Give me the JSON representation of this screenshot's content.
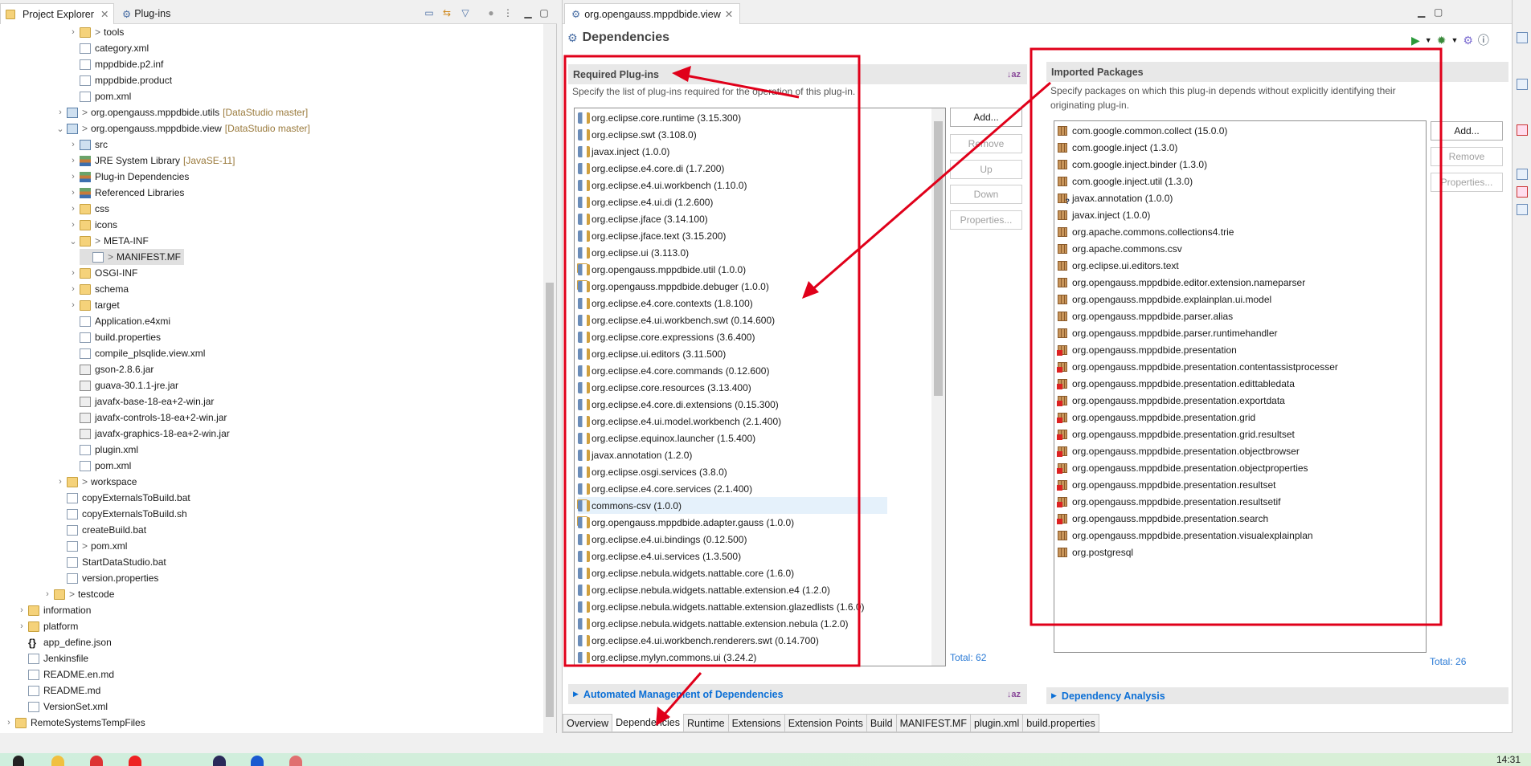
{
  "left_panel": {
    "tabs": [
      {
        "label": "Project Explorer",
        "active": true,
        "closable": true
      },
      {
        "label": "Plug-ins",
        "active": false
      }
    ],
    "toolbar_icons": [
      "collapse-all-icon",
      "link-with-editor-icon",
      "filter-icon",
      "focus-icon",
      "view-menu-icon",
      "minimize-icon",
      "maximize-icon"
    ],
    "tree": [
      {
        "label": "tools",
        "depth": 5,
        "chevron": "collapsed",
        "icon": "folder",
        "dirty": true
      },
      {
        "label": "category.xml",
        "depth": 5,
        "icon": "file"
      },
      {
        "label": "mppdbide.p2.inf",
        "depth": 5,
        "icon": "file"
      },
      {
        "label": "mppdbide.product",
        "depth": 5,
        "icon": "file"
      },
      {
        "label": "pom.xml",
        "depth": 5,
        "icon": "file"
      },
      {
        "label": "org.opengauss.mppdbide.utils",
        "depth": 4,
        "chevron": "collapsed",
        "icon": "proj",
        "dirty": true,
        "git": "[DataStudio master]"
      },
      {
        "label": "org.opengauss.mppdbide.view",
        "depth": 4,
        "chevron": "expanded",
        "icon": "proj",
        "dirty": true,
        "git": "[DataStudio master]"
      },
      {
        "label": "src",
        "depth": 5,
        "chevron": "collapsed",
        "icon": "proj"
      },
      {
        "label": "JRE System Library",
        "depth": 5,
        "chevron": "collapsed",
        "icon": "lib",
        "git": "[JavaSE-11]"
      },
      {
        "label": "Plug-in Dependencies",
        "depth": 5,
        "chevron": "collapsed",
        "icon": "lib"
      },
      {
        "label": "Referenced Libraries",
        "depth": 5,
        "chevron": "collapsed",
        "icon": "lib"
      },
      {
        "label": "css",
        "depth": 5,
        "chevron": "collapsed",
        "icon": "folder"
      },
      {
        "label": "icons",
        "depth": 5,
        "chevron": "collapsed",
        "icon": "folder"
      },
      {
        "label": "META-INF",
        "depth": 5,
        "chevron": "expanded",
        "icon": "folder",
        "dirty": true
      },
      {
        "label": "MANIFEST.MF",
        "depth": 6,
        "icon": "file",
        "dirty": true,
        "selected": true
      },
      {
        "label": "OSGI-INF",
        "depth": 5,
        "chevron": "collapsed",
        "icon": "folder"
      },
      {
        "label": "schema",
        "depth": 5,
        "chevron": "collapsed",
        "icon": "folder"
      },
      {
        "label": "target",
        "depth": 5,
        "chevron": "collapsed",
        "icon": "folder"
      },
      {
        "label": "Application.e4xmi",
        "depth": 5,
        "icon": "file"
      },
      {
        "label": "build.properties",
        "depth": 5,
        "icon": "file"
      },
      {
        "label": "compile_plsqlide.view.xml",
        "depth": 5,
        "icon": "file"
      },
      {
        "label": "gson-2.8.6.jar",
        "depth": 5,
        "icon": "jar"
      },
      {
        "label": "guava-30.1.1-jre.jar",
        "depth": 5,
        "icon": "jar"
      },
      {
        "label": "javafx-base-18-ea+2-win.jar",
        "depth": 5,
        "icon": "jar"
      },
      {
        "label": "javafx-controls-18-ea+2-win.jar",
        "depth": 5,
        "icon": "jar"
      },
      {
        "label": "javafx-graphics-18-ea+2-win.jar",
        "depth": 5,
        "icon": "jar"
      },
      {
        "label": "plugin.xml",
        "depth": 5,
        "icon": "file"
      },
      {
        "label": "pom.xml",
        "depth": 5,
        "icon": "file"
      },
      {
        "label": "workspace",
        "depth": 4,
        "chevron": "collapsed",
        "icon": "folder",
        "dirty": true
      },
      {
        "label": "copyExternalsToBuild.bat",
        "depth": 4,
        "icon": "file"
      },
      {
        "label": "copyExternalsToBuild.sh",
        "depth": 4,
        "icon": "file"
      },
      {
        "label": "createBuild.bat",
        "depth": 4,
        "icon": "file"
      },
      {
        "label": "pom.xml",
        "depth": 4,
        "icon": "file",
        "dirty": true
      },
      {
        "label": "StartDataStudio.bat",
        "depth": 4,
        "icon": "file"
      },
      {
        "label": "version.properties",
        "depth": 4,
        "icon": "file"
      },
      {
        "label": "testcode",
        "depth": 3,
        "chevron": "collapsed",
        "icon": "folder",
        "dirty": true
      },
      {
        "label": "information",
        "depth": 1,
        "chevron": "collapsed",
        "icon": "folder"
      },
      {
        "label": "platform",
        "depth": 1,
        "chevron": "collapsed",
        "icon": "folder"
      },
      {
        "label": "app_define.json",
        "depth": 1,
        "icon": "json"
      },
      {
        "label": "Jenkinsfile",
        "depth": 1,
        "icon": "file"
      },
      {
        "label": "README.en.md",
        "depth": 1,
        "icon": "file"
      },
      {
        "label": "README.md",
        "depth": 1,
        "icon": "file"
      },
      {
        "label": "VersionSet.xml",
        "depth": 1,
        "icon": "file"
      },
      {
        "label": "RemoteSystemsTempFiles",
        "depth": 0,
        "chevron": "collapsed",
        "icon": "folder"
      }
    ]
  },
  "editor": {
    "tab_label": "org.opengauss.mppdbide.view",
    "page_title": "Dependencies",
    "toolbar_icons": [
      "run-icon",
      "dropdown-icon",
      "debug-icon",
      "dropdown-icon",
      "plugin-icon",
      "help-icon"
    ],
    "required": {
      "title": "Required Plug-ins",
      "description": "Specify the list of plug-ins required for the operation of this plug-in.",
      "items": [
        {
          "label": "org.eclipse.core.runtime (3.15.300)"
        },
        {
          "label": "org.eclipse.swt (3.108.0)"
        },
        {
          "label": "javax.inject (1.0.0)"
        },
        {
          "label": "org.eclipse.e4.core.di (1.7.200)"
        },
        {
          "label": "org.eclipse.e4.ui.workbench (1.10.0)"
        },
        {
          "label": "org.eclipse.e4.ui.di (1.2.600)"
        },
        {
          "label": "org.eclipse.jface (3.14.100)"
        },
        {
          "label": "org.eclipse.jface.text (3.15.200)"
        },
        {
          "label": "org.eclipse.ui (3.113.0)"
        },
        {
          "label": "org.opengauss.mppdbide.util (1.0.0)",
          "workspace": true
        },
        {
          "label": "org.opengauss.mppdbide.debuger (1.0.0)",
          "workspace": true
        },
        {
          "label": "org.eclipse.e4.core.contexts (1.8.100)"
        },
        {
          "label": "org.eclipse.e4.ui.workbench.swt (0.14.600)"
        },
        {
          "label": "org.eclipse.core.expressions (3.6.400)"
        },
        {
          "label": "org.eclipse.ui.editors (3.11.500)"
        },
        {
          "label": "org.eclipse.e4.core.commands (0.12.600)"
        },
        {
          "label": "org.eclipse.core.resources (3.13.400)"
        },
        {
          "label": "org.eclipse.e4.core.di.extensions (0.15.300)"
        },
        {
          "label": "org.eclipse.e4.ui.model.workbench (2.1.400)"
        },
        {
          "label": "org.eclipse.equinox.launcher (1.5.400)"
        },
        {
          "label": "javax.annotation (1.2.0)"
        },
        {
          "label": "org.eclipse.osgi.services (3.8.0)"
        },
        {
          "label": "org.eclipse.e4.core.services (2.1.400)"
        },
        {
          "label": "commons-csv (1.0.0)",
          "workspace": true,
          "selected": true
        },
        {
          "label": "org.opengauss.mppdbide.adapter.gauss (1.0.0)",
          "workspace": true
        },
        {
          "label": "org.eclipse.e4.ui.bindings (0.12.500)"
        },
        {
          "label": "org.eclipse.e4.ui.services (1.3.500)"
        },
        {
          "label": "org.eclipse.nebula.widgets.nattable.core (1.6.0)"
        },
        {
          "label": "org.eclipse.nebula.widgets.nattable.extension.e4 (1.2.0)"
        },
        {
          "label": "org.eclipse.nebula.widgets.nattable.extension.glazedlists (1.6.0)"
        },
        {
          "label": "org.eclipse.nebula.widgets.nattable.extension.nebula (1.2.0)"
        },
        {
          "label": "org.eclipse.e4.ui.workbench.renderers.swt (0.14.700)"
        },
        {
          "label": "org.eclipse.mylyn.commons.ui (3.24.2)"
        }
      ],
      "buttons": [
        {
          "label": "Add...",
          "enabled": true
        },
        {
          "label": "Remove",
          "enabled": false
        },
        {
          "label": "Up",
          "enabled": false
        },
        {
          "label": "Down",
          "enabled": false
        },
        {
          "label": "Properties...",
          "enabled": false
        }
      ],
      "total": "Total: 62"
    },
    "imported": {
      "title": "Imported Packages",
      "description": "Specify packages on which this plug-in depends without explicitly identifying their originating plug-in.",
      "items": [
        {
          "label": "com.google.common.collect (15.0.0)"
        },
        {
          "label": "com.google.inject (1.3.0)"
        },
        {
          "label": "com.google.inject.binder (1.3.0)"
        },
        {
          "label": "com.google.inject.util (1.3.0)"
        },
        {
          "label": "javax.annotation (1.0.0)",
          "unresolved": true
        },
        {
          "label": "javax.inject (1.0.0)"
        },
        {
          "label": "org.apache.commons.collections4.trie"
        },
        {
          "label": "org.apache.commons.csv"
        },
        {
          "label": "org.eclipse.ui.editors.text"
        },
        {
          "label": "org.opengauss.mppdbide.editor.extension.nameparser"
        },
        {
          "label": "org.opengauss.mppdbide.explainplan.ui.model"
        },
        {
          "label": "org.opengauss.mppdbide.parser.alias"
        },
        {
          "label": "org.opengauss.mppdbide.parser.runtimehandler"
        },
        {
          "label": "org.opengauss.mppdbide.presentation",
          "error": true
        },
        {
          "label": "org.opengauss.mppdbide.presentation.contentassistprocesser",
          "error": true
        },
        {
          "label": "org.opengauss.mppdbide.presentation.edittabledata",
          "error": true
        },
        {
          "label": "org.opengauss.mppdbide.presentation.exportdata",
          "error": true
        },
        {
          "label": "org.opengauss.mppdbide.presentation.grid",
          "error": true
        },
        {
          "label": "org.opengauss.mppdbide.presentation.grid.resultset",
          "error": true
        },
        {
          "label": "org.opengauss.mppdbide.presentation.objectbrowser",
          "error": true
        },
        {
          "label": "org.opengauss.mppdbide.presentation.objectproperties",
          "error": true
        },
        {
          "label": "org.opengauss.mppdbide.presentation.resultset",
          "error": true
        },
        {
          "label": "org.opengauss.mppdbide.presentation.resultsetif",
          "error": true
        },
        {
          "label": "org.opengauss.mppdbide.presentation.search",
          "error": true
        },
        {
          "label": "org.opengauss.mppdbide.presentation.visualexplainplan"
        },
        {
          "label": "org.postgresql"
        }
      ],
      "buttons": [
        {
          "label": "Add...",
          "enabled": true
        },
        {
          "label": "Remove",
          "enabled": false
        },
        {
          "label": "Properties...",
          "enabled": false
        }
      ],
      "total": "Total: 26"
    },
    "automated": {
      "title": "Automated Management of Dependencies"
    },
    "analysis": {
      "title": "Dependency Analysis"
    },
    "bottom_tabs": [
      {
        "label": "Overview"
      },
      {
        "label": "Dependencies",
        "active": true
      },
      {
        "label": "Runtime"
      },
      {
        "label": "Extensions"
      },
      {
        "label": "Extension Points"
      },
      {
        "label": "Build"
      },
      {
        "label": "MANIFEST.MF"
      },
      {
        "label": "plugin.xml"
      },
      {
        "label": "build.properties"
      }
    ]
  },
  "taskbar": {
    "clock": "14:31"
  },
  "colors": {
    "annotation_red": "#e0001a",
    "link_blue": "#0b6fd6",
    "section_bg": "#e8e8e8",
    "selection": "#e5f1fb"
  }
}
